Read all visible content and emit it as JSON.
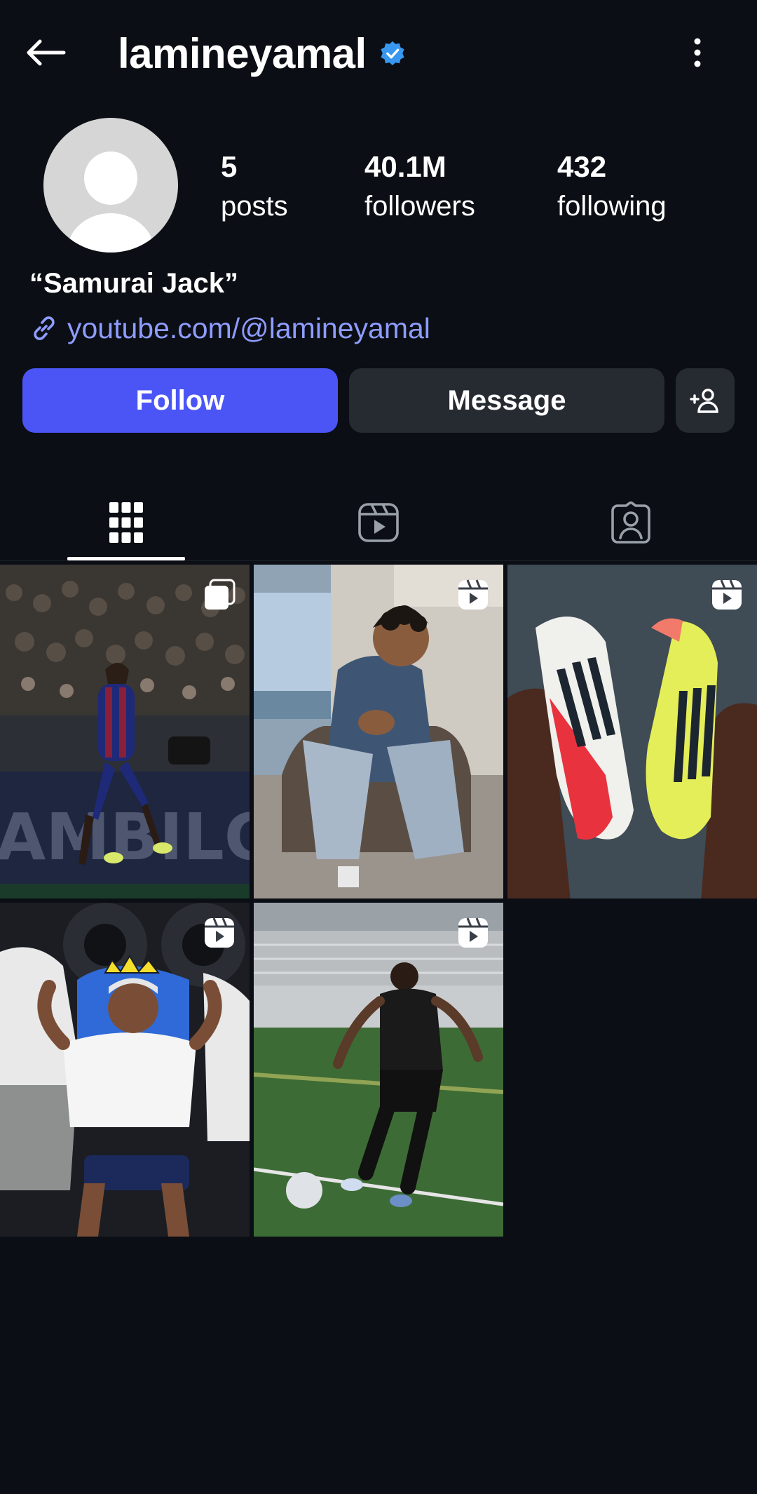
{
  "header": {
    "username": "lamineyamal",
    "verified": true
  },
  "profile": {
    "stats": [
      {
        "id": "posts",
        "value": "5",
        "label": "posts"
      },
      {
        "id": "followers",
        "value": "40.1M",
        "label": "followers"
      },
      {
        "id": "following",
        "value": "432",
        "label": "following"
      }
    ],
    "bio_name": "“Samurai Jack”",
    "link": "youtube.com/@lamineyamal"
  },
  "actions": {
    "follow_label": "Follow",
    "message_label": "Message"
  },
  "tabs": [
    "posts-grid",
    "reels",
    "tagged"
  ],
  "posts": [
    {
      "type": "carousel",
      "scene": "player celebrating in front of crowd"
    },
    {
      "type": "reel",
      "scene": "man in denim jacket seated in armchair"
    },
    {
      "type": "reel",
      "scene": "hands holding two football boots"
    },
    {
      "type": "reel",
      "scene": "player wearing drawn crown seated on chair"
    },
    {
      "type": "reel",
      "scene": "player kicking ball on pitch"
    }
  ],
  "colors": {
    "background": "#0b0e14",
    "follow_button": "#4b55f6",
    "secondary_button": "#262a31",
    "link": "#8e9cff",
    "verified_badge": "#3897f0"
  }
}
